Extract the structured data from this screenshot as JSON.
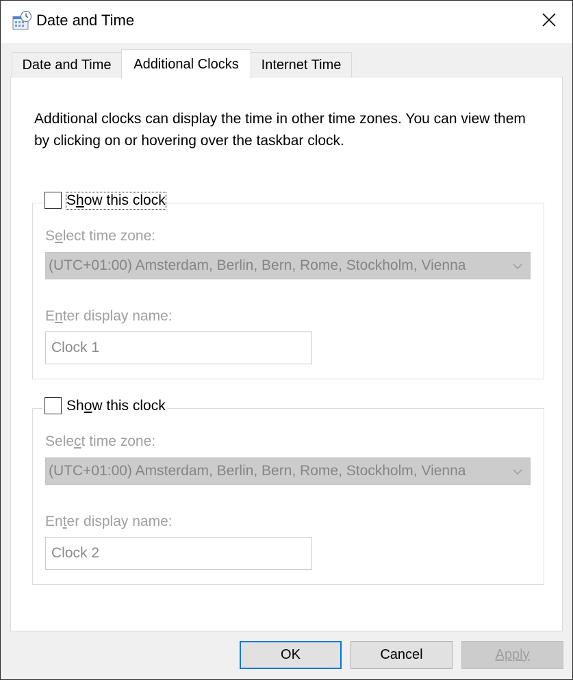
{
  "window": {
    "title": "Date and Time",
    "icons": {
      "app": "calendar-clock-icon",
      "close": "close-icon"
    }
  },
  "tabs": [
    {
      "label": "Date and Time",
      "active": false
    },
    {
      "label": "Additional Clocks",
      "active": true
    },
    {
      "label": "Internet Time",
      "active": false
    }
  ],
  "description": "Additional clocks can display the time in other time zones. You can view them by clicking on or hovering over the taskbar clock.",
  "clocks": [
    {
      "show_label_pre": "S",
      "show_label_ul": "h",
      "show_label_post": "ow this clock",
      "checked": false,
      "tz_label_pre": "S",
      "tz_label_ul": "e",
      "tz_label_post": "lect time zone:",
      "timezone": "(UTC+01:00) Amsterdam, Berlin, Bern, Rome, Stockholm, Vienna",
      "name_label_pre": "E",
      "name_label_ul": "n",
      "name_label_post": "ter display name:",
      "display_name": "Clock 1"
    },
    {
      "show_label_pre": "Sh",
      "show_label_ul": "o",
      "show_label_post": "w this clock",
      "checked": false,
      "tz_label_pre": "Sele",
      "tz_label_ul": "c",
      "tz_label_post": "t time zone:",
      "timezone": "(UTC+01:00) Amsterdam, Berlin, Bern, Rome, Stockholm, Vienna",
      "name_label_pre": "En",
      "name_label_ul": "t",
      "name_label_post": "er display name:",
      "display_name": "Clock 2"
    }
  ],
  "buttons": {
    "ok": "OK",
    "cancel": "Cancel",
    "apply": "Apply"
  },
  "colors": {
    "accent": "#0078d7",
    "disabled_text": "#a0a0a0",
    "disabled_combo_bg": "#cccccc"
  }
}
